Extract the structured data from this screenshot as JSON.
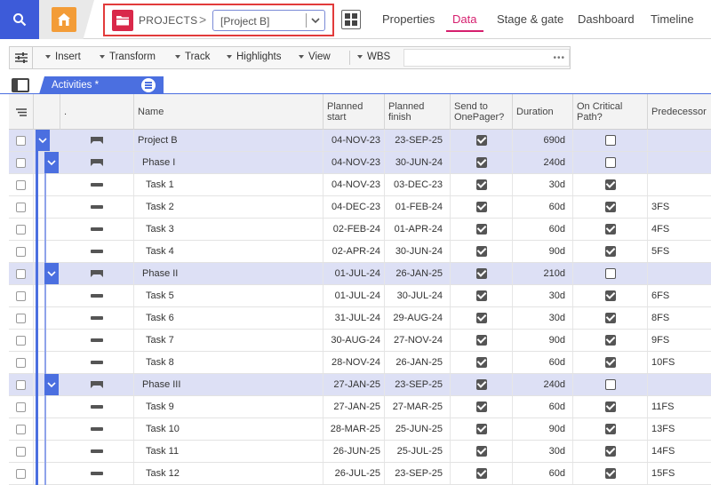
{
  "topbar": {
    "breadcrumb_root": "PROJECTS",
    "breadcrumb_sep": ">",
    "project_value": "[Project B]",
    "tabs": [
      {
        "label": "Properties",
        "active": false
      },
      {
        "label": "Data",
        "active": true
      },
      {
        "label": "Stage & gate",
        "active": false
      },
      {
        "label": "Dashboard",
        "active": false
      },
      {
        "label": "Timeline",
        "active": false
      }
    ]
  },
  "toolbar": {
    "items": [
      "Insert",
      "Transform",
      "Track",
      "Highlights",
      "View"
    ],
    "wbs_label": "WBS",
    "wbs_dots": "•••"
  },
  "sheet_tab": {
    "label": "Activities *"
  },
  "columns": {
    "dot": ".",
    "name": "Name",
    "planned_start": "Planned start",
    "planned_finish": "Planned finish",
    "send": "Send to OnePager?",
    "duration": "Duration",
    "critical": "On Critical Path?",
    "predecessor": "Predecessor"
  },
  "rows": [
    {
      "level": 0,
      "name": "Project B",
      "start": "04-NOV-23",
      "finish": "23-SEP-25",
      "send": true,
      "duration": "690d",
      "critical": false,
      "pred": ""
    },
    {
      "level": 1,
      "name": "Phase I",
      "start": "04-NOV-23",
      "finish": "30-JUN-24",
      "send": true,
      "duration": "240d",
      "critical": false,
      "pred": ""
    },
    {
      "level": 2,
      "name": "Task 1",
      "start": "04-NOV-23",
      "finish": "03-DEC-23",
      "send": true,
      "duration": "30d",
      "critical": true,
      "pred": ""
    },
    {
      "level": 2,
      "name": "Task 2",
      "start": "04-DEC-23",
      "finish": "01-FEB-24",
      "send": true,
      "duration": "60d",
      "critical": true,
      "pred": "3FS"
    },
    {
      "level": 2,
      "name": "Task 3",
      "start": "02-FEB-24",
      "finish": "01-APR-24",
      "send": true,
      "duration": "60d",
      "critical": true,
      "pred": "4FS"
    },
    {
      "level": 2,
      "name": "Task 4",
      "start": "02-APR-24",
      "finish": "30-JUN-24",
      "send": true,
      "duration": "90d",
      "critical": true,
      "pred": "5FS"
    },
    {
      "level": 1,
      "name": "Phase II",
      "start": "01-JUL-24",
      "finish": "26-JAN-25",
      "send": true,
      "duration": "210d",
      "critical": false,
      "pred": ""
    },
    {
      "level": 2,
      "name": "Task 5",
      "start": "01-JUL-24",
      "finish": "30-JUL-24",
      "send": true,
      "duration": "30d",
      "critical": true,
      "pred": "6FS"
    },
    {
      "level": 2,
      "name": "Task 6",
      "start": "31-JUL-24",
      "finish": "29-AUG-24",
      "send": true,
      "duration": "30d",
      "critical": true,
      "pred": "8FS"
    },
    {
      "level": 2,
      "name": "Task 7",
      "start": "30-AUG-24",
      "finish": "27-NOV-24",
      "send": true,
      "duration": "90d",
      "critical": true,
      "pred": "9FS"
    },
    {
      "level": 2,
      "name": "Task 8",
      "start": "28-NOV-24",
      "finish": "26-JAN-25",
      "send": true,
      "duration": "60d",
      "critical": true,
      "pred": "10FS"
    },
    {
      "level": 1,
      "name": "Phase III",
      "start": "27-JAN-25",
      "finish": "23-SEP-25",
      "send": true,
      "duration": "240d",
      "critical": false,
      "pred": ""
    },
    {
      "level": 2,
      "name": "Task 9",
      "start": "27-JAN-25",
      "finish": "27-MAR-25",
      "send": true,
      "duration": "60d",
      "critical": true,
      "pred": "11FS"
    },
    {
      "level": 2,
      "name": "Task 10",
      "start": "28-MAR-25",
      "finish": "25-JUN-25",
      "send": true,
      "duration": "90d",
      "critical": true,
      "pred": "13FS"
    },
    {
      "level": 2,
      "name": "Task 11",
      "start": "26-JUN-25",
      "finish": "25-JUL-25",
      "send": true,
      "duration": "30d",
      "critical": true,
      "pred": "14FS"
    },
    {
      "level": 2,
      "name": "Task 12",
      "start": "26-JUL-25",
      "finish": "23-SEP-25",
      "send": true,
      "duration": "60d",
      "critical": true,
      "pred": "15FS"
    }
  ],
  "colors": {
    "accent": "#4b6fe0",
    "active_tab": "#d61f6e",
    "highlight_border": "#e23b3b",
    "summary_row": "#dde0f5"
  }
}
